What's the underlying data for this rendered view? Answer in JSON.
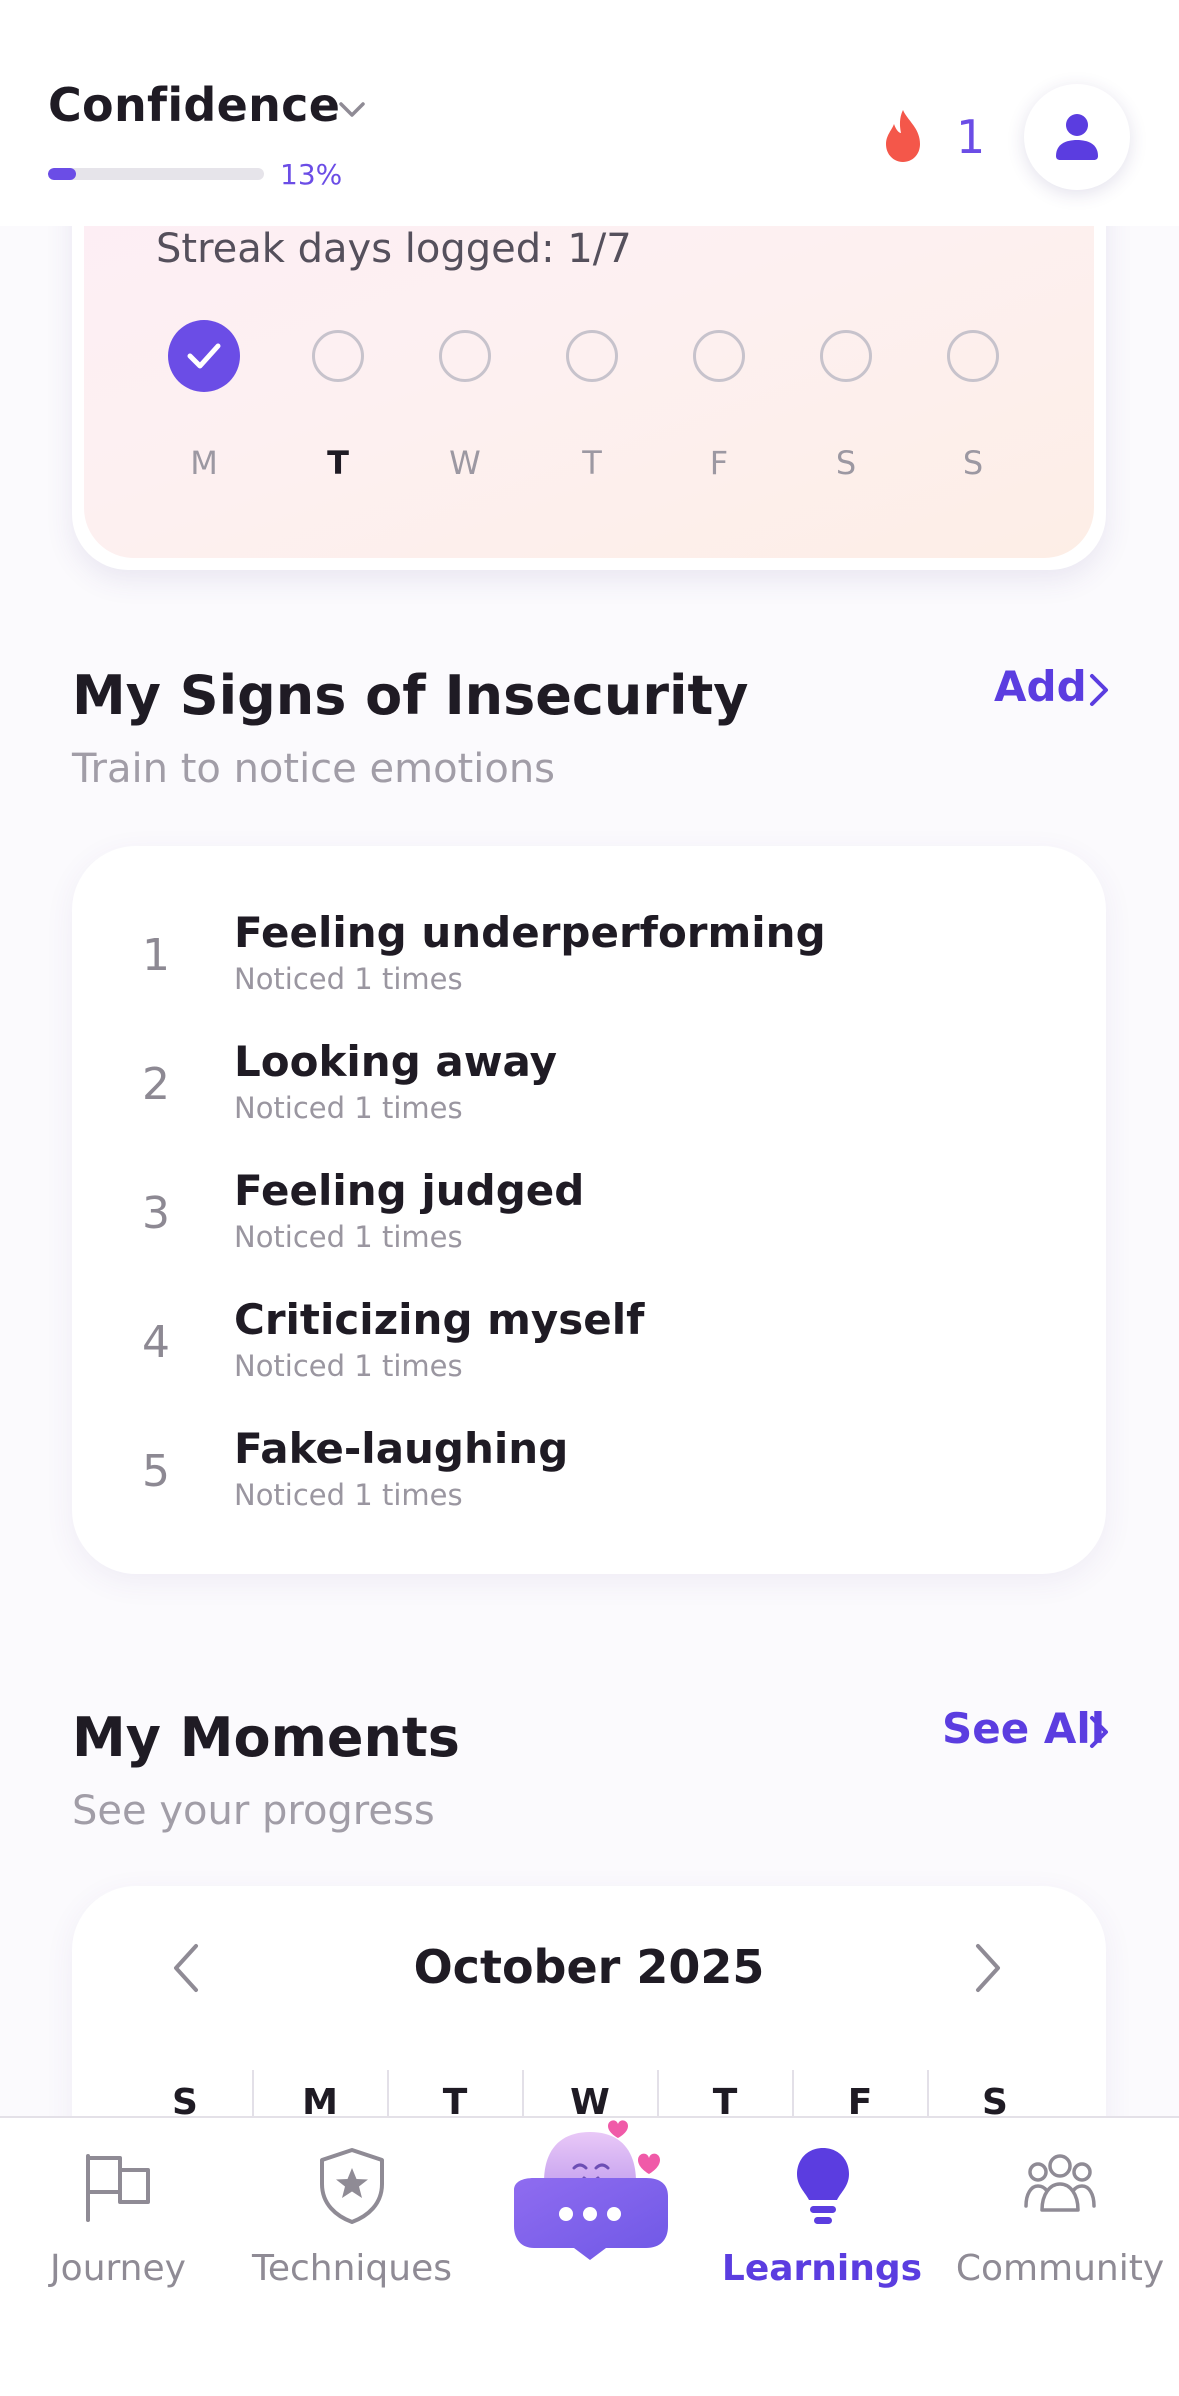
{
  "header": {
    "goal_title": "Confidence",
    "progress_percent": 13,
    "progress_label": "13%",
    "streak_count": "1",
    "icons": [
      "chevron-down-icon",
      "flame-icon",
      "user-icon"
    ]
  },
  "streak": {
    "label": "Streak days logged: 1/7",
    "days": [
      {
        "letter": "M",
        "done": true,
        "today": false
      },
      {
        "letter": "T",
        "done": false,
        "today": true
      },
      {
        "letter": "W",
        "done": false,
        "today": false
      },
      {
        "letter": "T",
        "done": false,
        "today": false
      },
      {
        "letter": "F",
        "done": false,
        "today": false
      },
      {
        "letter": "S",
        "done": false,
        "today": false
      },
      {
        "letter": "S",
        "done": false,
        "today": false
      }
    ]
  },
  "signs": {
    "title": "My Signs of Insecurity",
    "subtitle": "Train to notice emotions",
    "action": "Add",
    "items": [
      {
        "num": "1",
        "name": "Feeling underperforming",
        "count": "Noticed 1 times"
      },
      {
        "num": "2",
        "name": "Looking away",
        "count": "Noticed 1 times"
      },
      {
        "num": "3",
        "name": "Feeling judged",
        "count": "Noticed 1 times"
      },
      {
        "num": "4",
        "name": "Criticizing myself",
        "count": "Noticed 1 times"
      },
      {
        "num": "5",
        "name": "Fake-laughing",
        "count": "Noticed 1 times"
      }
    ]
  },
  "moments": {
    "title": "My Moments",
    "subtitle": "See your progress",
    "action": "See All",
    "month": "October 2025",
    "weekdays": [
      "S",
      "M",
      "T",
      "W",
      "T",
      "F",
      "S"
    ]
  },
  "nav": {
    "items": [
      {
        "label": "Journey",
        "icon": "flag-icon",
        "active": false
      },
      {
        "label": "Techniques",
        "icon": "shield-star-icon",
        "active": false
      },
      {
        "label": "",
        "icon": "chat-mascot-icon",
        "active": false
      },
      {
        "label": "Learnings",
        "icon": "lightbulb-icon",
        "active": true
      },
      {
        "label": "Community",
        "icon": "community-icon",
        "active": false
      }
    ]
  },
  "colors": {
    "accent": "#5b3de0",
    "accent_fill": "#6b4de6",
    "flame": "#f4574a",
    "muted": "#9c98a2"
  }
}
